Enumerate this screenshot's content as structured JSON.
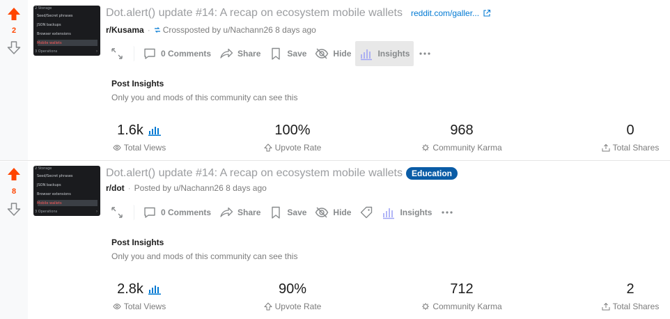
{
  "posts": [
    {
      "score": "2",
      "title": "Dot.alert() update #14: A recap on ecosystem mobile wallets",
      "link": "reddit.com/galler...",
      "flair": "",
      "subreddit": "r/Kusama",
      "posted_by": "Crossposted by u/Nachann26 8 days ago",
      "thumbnail_lines": [
        "2 Storage",
        "Seed/Secret phrases",
        "JSON backups",
        "Browser extensions",
        "Mobile wallets",
        "3 Operations"
      ],
      "actions": {
        "comments": "0 Comments",
        "share": "Share",
        "save": "Save",
        "hide": "Hide",
        "insights": "Insights"
      },
      "insights": {
        "title": "Post Insights",
        "subtitle": "Only you and mods of this community can see this",
        "total_views": "1.6k",
        "total_views_label": "Total Views",
        "upvote_rate": "100%",
        "upvote_rate_label": "Upvote Rate",
        "community_karma": "968",
        "community_karma_label": "Community Karma",
        "total_shares": "0",
        "total_shares_label": "Total Shares"
      }
    },
    {
      "score": "8",
      "title": "Dot.alert() update #14: A recap on ecosystem mobile wallets",
      "link": "",
      "flair": "Education",
      "subreddit": "r/dot",
      "posted_by": "Posted by u/Nachann26 8 days ago",
      "thumbnail_lines": [
        "2 Storage",
        "Seed/Secret phrases",
        "JSON backups",
        "Browser extensions",
        "Mobile wallets",
        "3 Operations"
      ],
      "actions": {
        "comments": "0 Comments",
        "share": "Share",
        "save": "Save",
        "hide": "Hide",
        "insights": "Insights"
      },
      "insights": {
        "title": "Post Insights",
        "subtitle": "Only you and mods of this community can see this",
        "total_views": "2.8k",
        "total_views_label": "Total Views",
        "upvote_rate": "90%",
        "upvote_rate_label": "Upvote Rate",
        "community_karma": "712",
        "community_karma_label": "Community Karma",
        "total_shares": "2",
        "total_shares_label": "Total Shares"
      }
    }
  ],
  "colors": {
    "upvote": "#ff4500",
    "link": "#0079d3",
    "flair_bg": "#0a5ca6",
    "insights_bar": "#0079d3"
  },
  "icons": [
    "upvote-icon",
    "downvote-icon",
    "external-link-icon",
    "crosspost-icon",
    "expand-icon",
    "comment-icon",
    "share-icon",
    "save-icon",
    "hide-icon",
    "tag-icon",
    "insights-icon",
    "more-icon",
    "eye-icon",
    "upvote-rate-icon",
    "karma-icon",
    "share-out-icon"
  ]
}
